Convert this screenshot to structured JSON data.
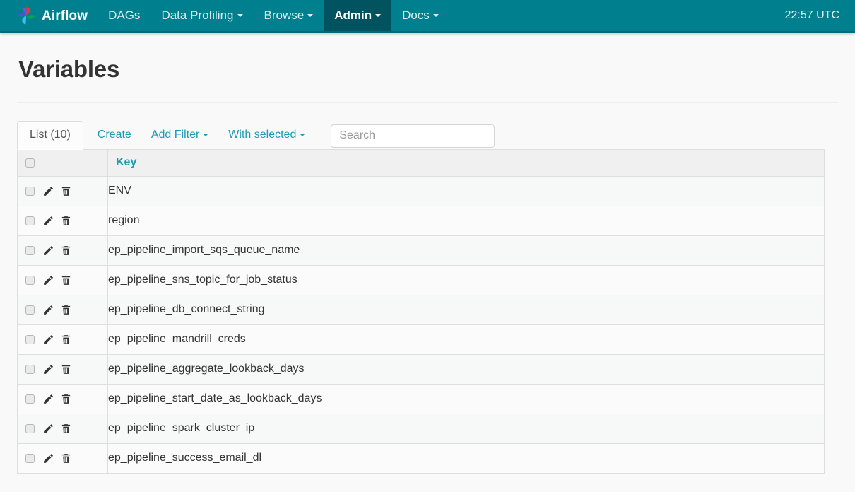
{
  "navbar": {
    "brand": "Airflow",
    "brand_logo_icon": "airflow-pinwheel-logo",
    "items": [
      {
        "label": "DAGs",
        "has_caret": false,
        "active": false
      },
      {
        "label": "Data Profiling",
        "has_caret": true,
        "active": false
      },
      {
        "label": "Browse",
        "has_caret": true,
        "active": false
      },
      {
        "label": "Admin",
        "has_caret": true,
        "active": true
      },
      {
        "label": "Docs",
        "has_caret": true,
        "active": false
      }
    ],
    "clock": "22:57 UTC",
    "background_color": "#00808f",
    "active_color": "#01545f"
  },
  "page": {
    "title": "Variables"
  },
  "toolbar": {
    "list_tab": "List (10)",
    "create": "Create",
    "add_filter": "Add Filter",
    "with_selected": "With selected",
    "search_placeholder": "Search",
    "search_value": "",
    "link_color": "#1f9bb1"
  },
  "table": {
    "columns": [
      "",
      "",
      "Key"
    ],
    "key_header": "Key",
    "edit_icon": "pencil-icon",
    "delete_icon": "trash-icon",
    "rows": [
      {
        "key": "ENV"
      },
      {
        "key": "region"
      },
      {
        "key": "ep_pipeline_import_sqs_queue_name"
      },
      {
        "key": "ep_pipeline_sns_topic_for_job_status"
      },
      {
        "key": "ep_pipeline_db_connect_string"
      },
      {
        "key": "ep_pipeline_mandrill_creds"
      },
      {
        "key": "ep_pipeline_aggregate_lookback_days"
      },
      {
        "key": "ep_pipeline_start_date_as_lookback_days"
      },
      {
        "key": "ep_pipeline_spark_cluster_ip"
      },
      {
        "key": "ep_pipeline_success_email_dl"
      }
    ]
  }
}
